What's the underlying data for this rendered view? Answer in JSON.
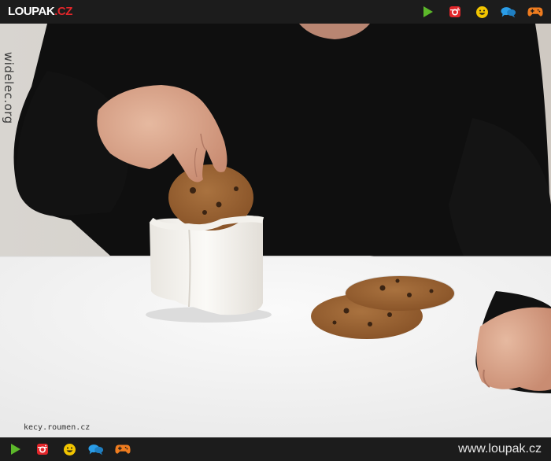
{
  "header": {
    "logo_main": "LOUPAK",
    "logo_dot": ".",
    "logo_tld": "CZ",
    "icons": [
      "play-icon",
      "instagram-icon",
      "smiley-icon",
      "chat-icon",
      "gamepad-icon"
    ]
  },
  "photo": {
    "watermark_side": "widelec.org",
    "watermark_bottom": "kecy.roumen.cz"
  },
  "footer": {
    "url": "www.loupak.cz",
    "icons": [
      "play-icon",
      "instagram-icon",
      "smiley-icon",
      "chat-icon",
      "gamepad-icon"
    ]
  },
  "colors": {
    "bar": "#1c1c1c",
    "play": "#5cb82a",
    "instagram": "#e2262a",
    "smiley": "#f2c500",
    "chat": "#2a9de8",
    "gamepad": "#ef7c1f"
  }
}
